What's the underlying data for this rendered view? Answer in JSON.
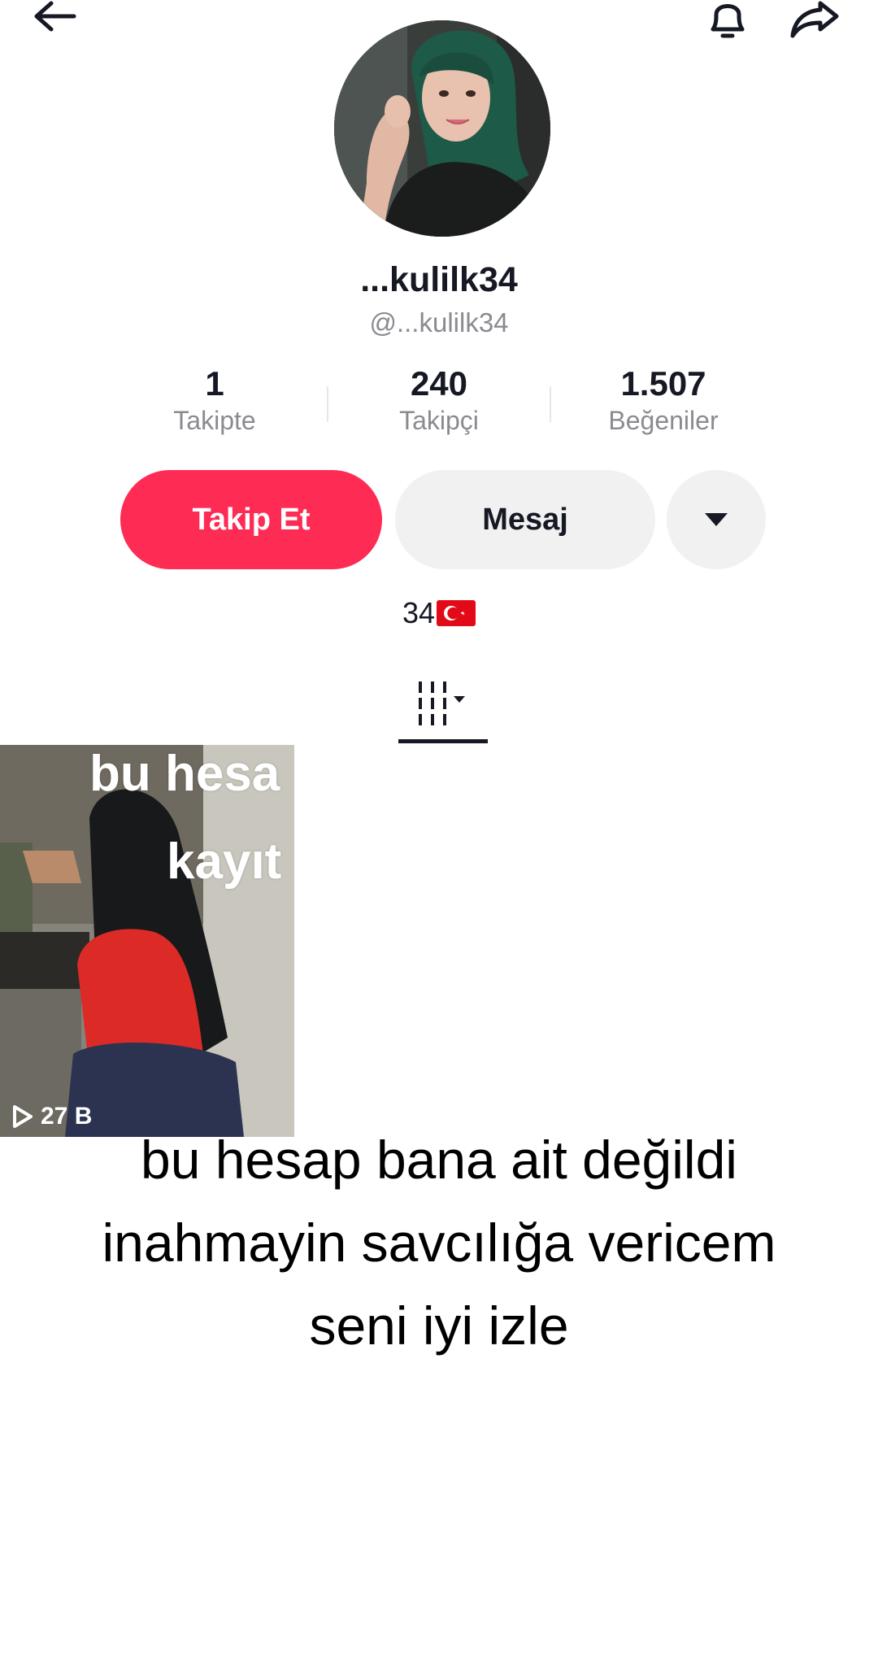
{
  "profile": {
    "display_name": "...kulilk34",
    "handle": "@...kulilk34",
    "bio": "34",
    "bio_flag": "turkey-flag-emoji"
  },
  "stats": [
    {
      "value": "1",
      "label": "Takipte"
    },
    {
      "value": "240",
      "label": "Takipçi"
    },
    {
      "value": "1.507",
      "label": "Beğeniler"
    }
  ],
  "actions": {
    "follow_label": "Takip Et",
    "message_label": "Mesaj",
    "more_icon": "caret-down-icon"
  },
  "colors": {
    "follow_button": "#fe2c55",
    "secondary_button": "#f1f1f2",
    "muted_text": "#8a8b91"
  },
  "tabs": {
    "active_icon": "grid-icon"
  },
  "video": {
    "overlay_line1": "bu hesa",
    "overlay_line2": "kayıt",
    "views": "27 B"
  },
  "caption": {
    "line1": "bu hesap bana ait değildi",
    "line2": "inahmayin savcılığa vericem",
    "line3": "seni iyi izle"
  }
}
